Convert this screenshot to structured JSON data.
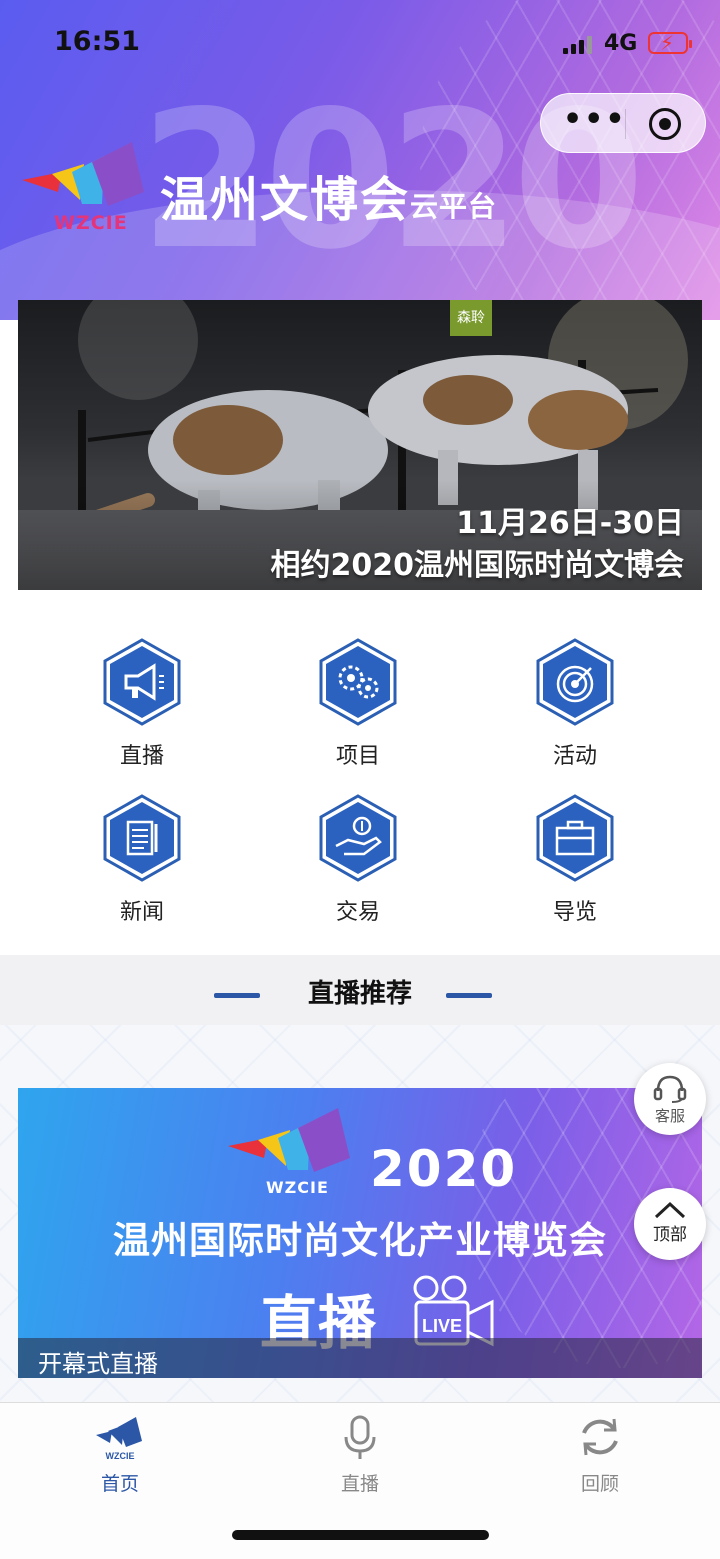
{
  "status_bar": {
    "time": "16:51",
    "network": "4G"
  },
  "header": {
    "logo_text": "WZCIE",
    "title": "温州文博会",
    "subtitle": "云平台",
    "background_year": "2020"
  },
  "banner": {
    "sign_text": "森聆",
    "caption_date": "11月26日-30日",
    "caption_title": "相约2020温州国际时尚文博会"
  },
  "menu": {
    "items": [
      {
        "label": "直播",
        "icon": "megaphone-icon"
      },
      {
        "label": "项目",
        "icon": "gears-icon"
      },
      {
        "label": "活动",
        "icon": "target-icon"
      },
      {
        "label": "新闻",
        "icon": "document-icon"
      },
      {
        "label": "交易",
        "icon": "hand-coin-icon"
      },
      {
        "label": "导览",
        "icon": "briefcase-icon"
      }
    ]
  },
  "section": {
    "title": "直播推荐"
  },
  "live_card": {
    "logo_text": "WZCIE",
    "year": "2020",
    "expo_name": "温州国际时尚文化产业博览会",
    "live_text": "直播",
    "cam_label": "LIVE",
    "footer_label": "开幕式直播"
  },
  "floating": {
    "service_label": "客服",
    "top_label": "顶部"
  },
  "tabbar": {
    "items": [
      {
        "label": "首页",
        "icon": "home-logo-icon",
        "active": true
      },
      {
        "label": "直播",
        "icon": "microphone-icon",
        "active": false
      },
      {
        "label": "回顾",
        "icon": "refresh-icon",
        "active": false
      }
    ],
    "logo_small": "WZCIE"
  },
  "colors": {
    "accent": "#2b57a6",
    "header_start": "#5a5cf0",
    "header_end": "#e08ae6"
  }
}
